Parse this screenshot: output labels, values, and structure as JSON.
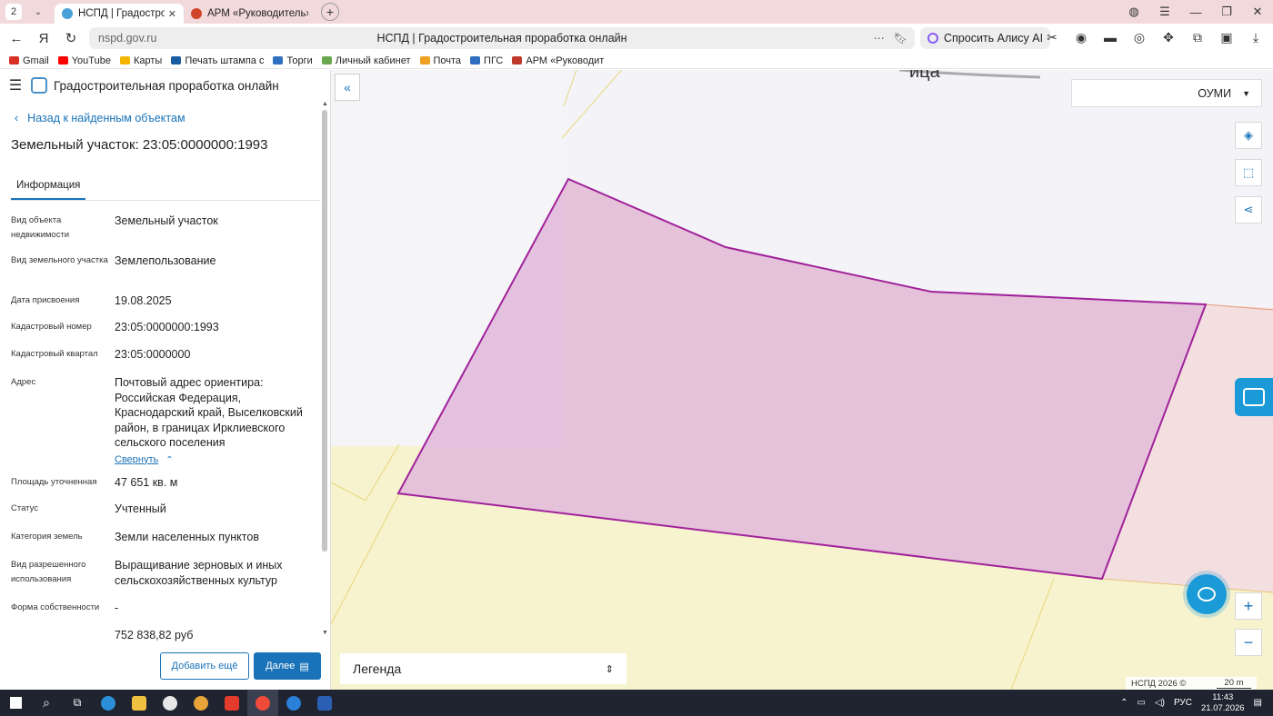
{
  "browser": {
    "tab_count": "2",
    "tabs": [
      {
        "title": "НСПД | Градостроител",
        "active": true
      },
      {
        "title": "АРМ «Руководитель»",
        "active": false
      }
    ],
    "url_host": "nspd.gov.ru",
    "page_title": "НСПД | Градостроительная проработка онлайн",
    "alice_label": "Спросить Алису AI",
    "bookmarks": [
      {
        "label": "Gmail",
        "color": "#d93025"
      },
      {
        "label": "YouTube",
        "color": "#ff0000"
      },
      {
        "label": "Карты",
        "color": "#f4b400"
      },
      {
        "label": "Печать штампа с",
        "color": "#1a5aa0"
      },
      {
        "label": "Торги",
        "color": "#2f6fc0"
      },
      {
        "label": "Личный кабинет",
        "color": "#6aa84f"
      },
      {
        "label": "Почта",
        "color": "#f0a020"
      },
      {
        "label": "ПГС",
        "color": "#2f6fc0"
      },
      {
        "label": "АРМ «Руководит",
        "color": "#c0392b"
      }
    ]
  },
  "app": {
    "title": "Градостроительная проработка онлайн",
    "back_link": "Назад к найденным объектам",
    "object_title": "Земельный участок: 23:05:0000000:1993",
    "tab_info": "Информация",
    "properties": [
      {
        "label": "Вид объекта недвижимости",
        "value": "Земельный участок"
      },
      {
        "label": "Вид земельного участка",
        "value": "Землепользование"
      },
      {
        "label": "Дата присвоения",
        "value": "19.08.2025"
      },
      {
        "label": "Кадастровый номер",
        "value": "23:05:0000000:1993"
      },
      {
        "label": "Кадастровый квартал",
        "value": "23:05:0000000"
      },
      {
        "label": "Адрес",
        "value": "Почтовый адрес ориентира: Российская Федерация, Краснодарский край, Выселковский район, в границах Ирклиевского сельского поселения"
      },
      {
        "label": "Площадь уточненная",
        "value": "47 651 кв. м"
      },
      {
        "label": "Статус",
        "value": "Учтенный"
      },
      {
        "label": "Категория земель",
        "value": "Земли населенных пунктов"
      },
      {
        "label": "Вид разрешенного использования",
        "value": "Выращивание зерновых и иных сельскохозяйственных культур"
      },
      {
        "label": "Форма собственности",
        "value": "-"
      }
    ],
    "collapse_label": "Свернуть",
    "partial_value": "752 838,82 руб",
    "btn_add_more": "Добавить ещё",
    "btn_next": "Далее"
  },
  "map": {
    "layer_label": "ОУМИ",
    "legend_label": "Легенда",
    "copyright": "НСПД 2026 ©",
    "scale_label": "20 m",
    "street_fragment": "ица",
    "parcel_fill": "#e2b7dc",
    "parcel_stroke": "#a0229a"
  },
  "taskbar": {
    "lang": "РУС",
    "time": "11:43",
    "date": "21.07.2026"
  }
}
